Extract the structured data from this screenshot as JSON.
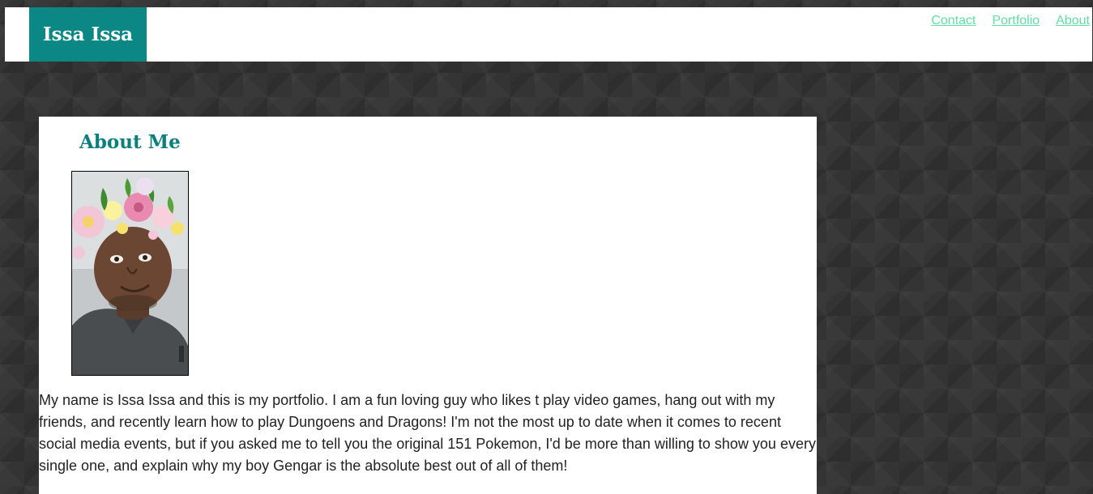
{
  "header": {
    "brand": "Issa Issa",
    "nav": [
      {
        "label": "Contact"
      },
      {
        "label": "Portfolio"
      },
      {
        "label": "About"
      }
    ]
  },
  "about": {
    "title": "About Me",
    "photo": {
      "description_icon": "profile-photo"
    },
    "bio": "My name is Issa Issa and this is my portfolio. I am a fun loving guy who likes t play video games, hang out with my friends, and recently learn how to play Dungoens and Dragons! I'm not the most up to date when it comes to recent social media events, but if you asked me to tell you the original 151 Pokemon, I'd be more than willing to show you every single one, and explain why my boy Gengar is the absolute best out of all of them!"
  },
  "colors": {
    "brand": "#0b8885",
    "title": "#0b7f7d",
    "nav_link": "#5fe0a4",
    "background": "#343434"
  }
}
